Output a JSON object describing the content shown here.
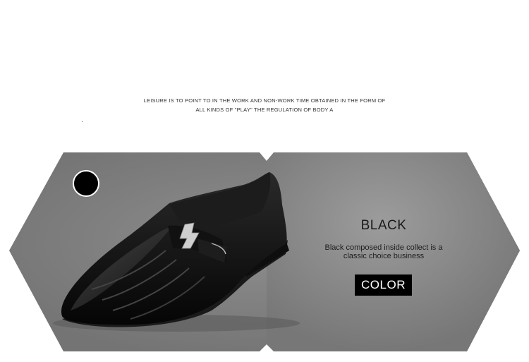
{
  "tagline": {
    "line1": "LEISURE IS TO POINT TO IN THE WORK AND NON-WORK TIME  OBTAINED IN THE FORM OF",
    "line2": "ALL KINDS OF \"PLAY\" THE REGULATION OF BODY A"
  },
  "product": {
    "image_icon": "black-leather-dress-shoe",
    "swatch_color": "#000000",
    "color_name": "BLACK",
    "description": "Black composed inside collect is a classic choice business",
    "color_button": "COLOR"
  },
  "colors": {
    "panel": "#7a7a7a",
    "panel_light": "#9a9a9a",
    "button_bg": "#000000",
    "button_text": "#ffffff"
  }
}
